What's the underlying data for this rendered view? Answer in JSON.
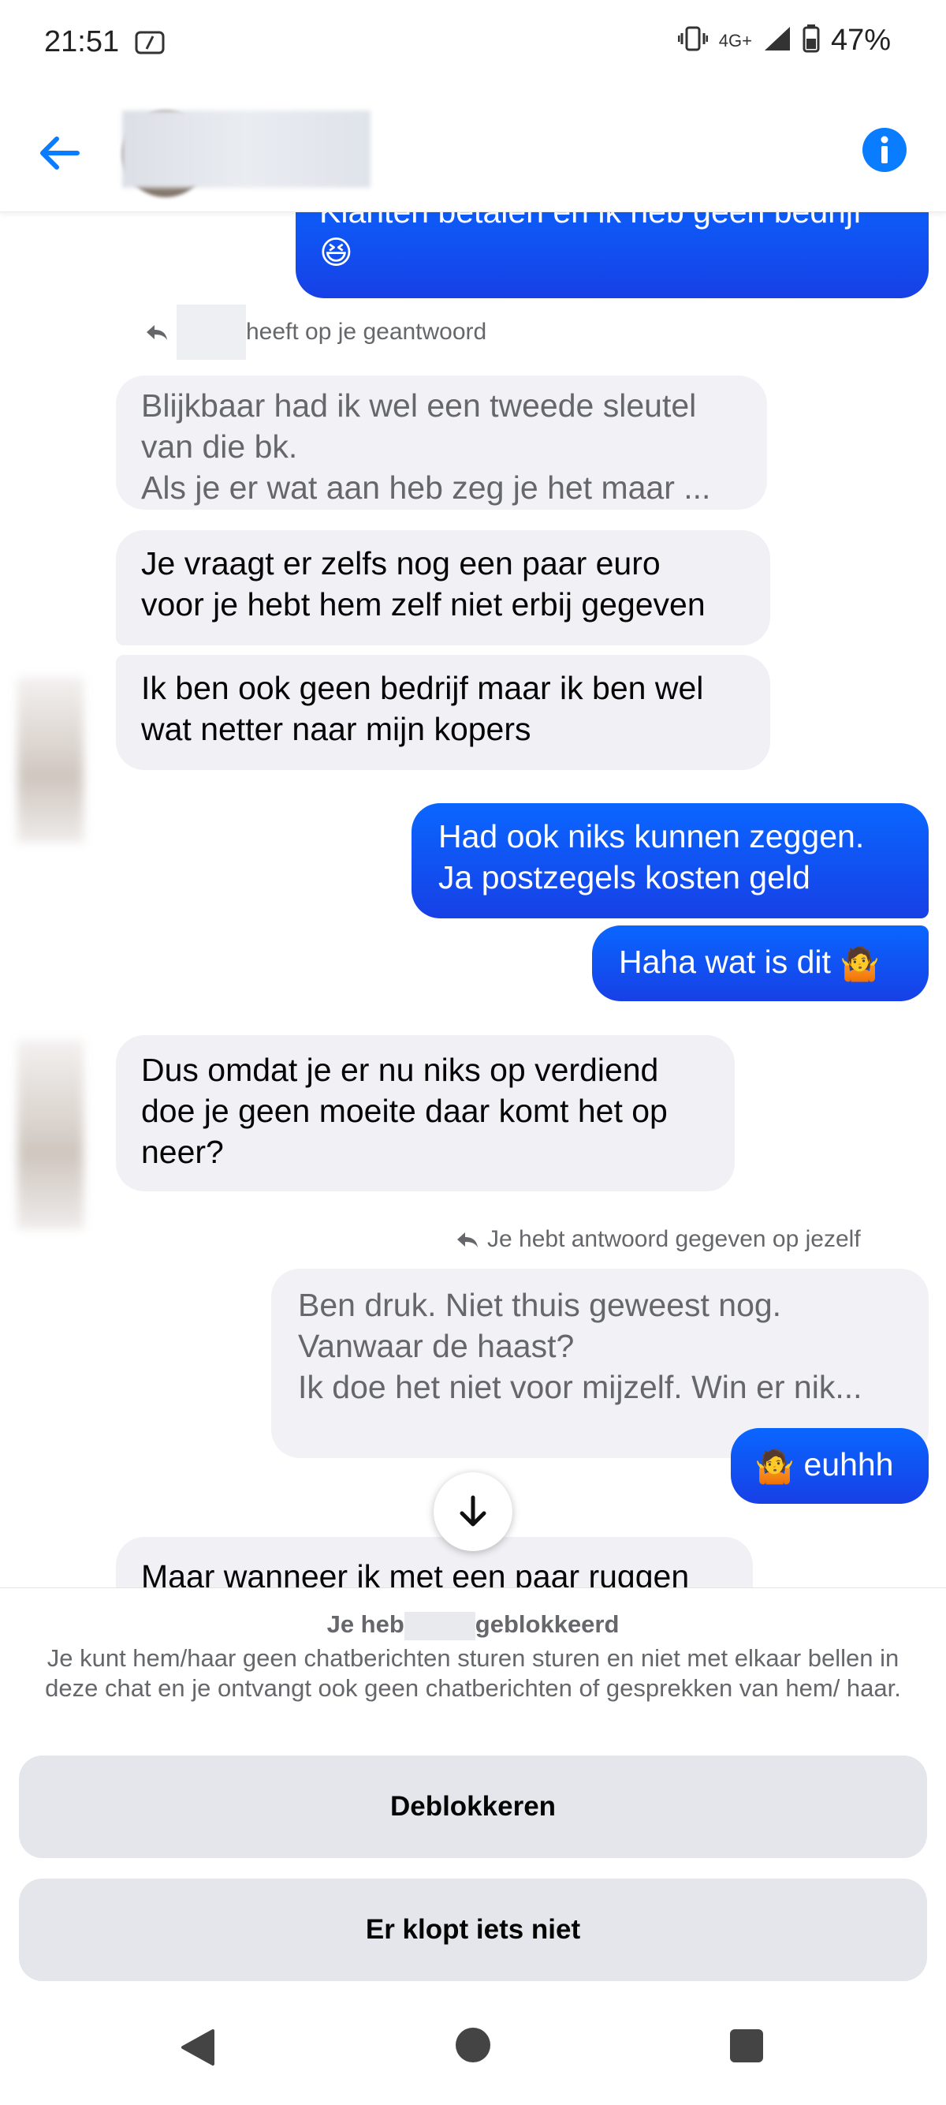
{
  "status_bar": {
    "time": "21:51",
    "network": "4G+",
    "battery": "47%"
  },
  "header": {
    "back_icon": "arrow-left-icon",
    "info_icon": "info-icon",
    "accent_color": "#0a7cff"
  },
  "messages": {
    "m1_line1": "Klanten betalen en ik heb geen bedrijf",
    "m1_emoji": "😆",
    "reply_note_1": "heeft op je geantwoord",
    "q1_line1": "Blijkbaar had ik wel een tweede sleutel",
    "q1_line2": "van die bk.",
    "q1_line3": "Als je er wat aan heb zeg je het maar ...",
    "m2_line1": "Je vraagt er zelfs nog een paar euro",
    "m2_line2": "voor je hebt hem zelf niet erbij gegeven",
    "m3_line1": "Ik ben ook geen bedrijf maar ik ben wel",
    "m3_line2": "wat netter naar mijn kopers",
    "m4_line1": "Had ook niks kunnen zeggen.",
    "m4_line2": "Ja postzegels kosten geld",
    "m5_text": "Haha wat is dit",
    "m5_emoji": "🤷",
    "m6_line1": "Dus omdat je er nu niks op verdiend",
    "m6_line2": "doe je geen moeite daar komt het op",
    "m6_line3": "neer?",
    "reply_note_2": "Je hebt antwoord gegeven op jezelf",
    "q2_line1": "Ben druk. Niet thuis geweest nog.",
    "q2_line2": "Vanwaar de haast?",
    "q2_line3": "Ik doe het niet voor mijzelf. Win er nik...",
    "m7_emoji": "🤷",
    "m7_text": "euhhh",
    "m8_partial": "Maar wanneer ik met een paar ruggen"
  },
  "blocked": {
    "title_pre": "Je heb",
    "title_post": "geblokkeerd",
    "description": "Je kunt hem/haar geen chatberichten sturen sturen en niet met elkaar bellen in deze chat en je ontvangt ook geen chatberichten of gesprekken van hem/ haar.",
    "unblock_label": "Deblokkeren",
    "report_label": "Er klopt iets niet"
  },
  "colors": {
    "outgoing_bubble": "#0a66ff",
    "incoming_bubble": "#f0f0f5",
    "button_bg": "#e4e6eb"
  }
}
